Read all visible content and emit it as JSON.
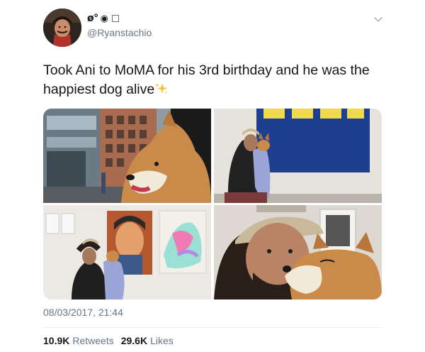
{
  "user": {
    "display_name": "ø°",
    "display_circle": "◉",
    "handle": "@Ryanstachio",
    "avatar_icon": "profile-photo"
  },
  "menu": {
    "icon": "chevron-down-icon"
  },
  "tweet": {
    "text": "Took Ani to MoMA for his 3rd birthday and he was the happiest dog alive",
    "emoji": "sparkles"
  },
  "media": [
    {
      "name": "photo-corgi-in-car",
      "subject": "corgi looking out car window on city street"
    },
    {
      "name": "photo-man-holding-corgi-blue-painting",
      "subject": "man holding corgi in front of blue painting"
    },
    {
      "name": "photo-man-holding-corgi-portraits",
      "subject": "man holding corgi in front of pop-art portraits"
    },
    {
      "name": "photo-selfie-with-corgi",
      "subject": "selfie of man with corgi"
    }
  ],
  "timestamp": "08/03/2017, 21:44",
  "stats": {
    "retweets_count": "10.9K",
    "retweets_label": "Retweets",
    "likes_count": "29.6K",
    "likes_label": "Likes"
  },
  "colors": {
    "text": "#14171a",
    "secondary": "#657786",
    "divider": "#e6ecf0"
  }
}
